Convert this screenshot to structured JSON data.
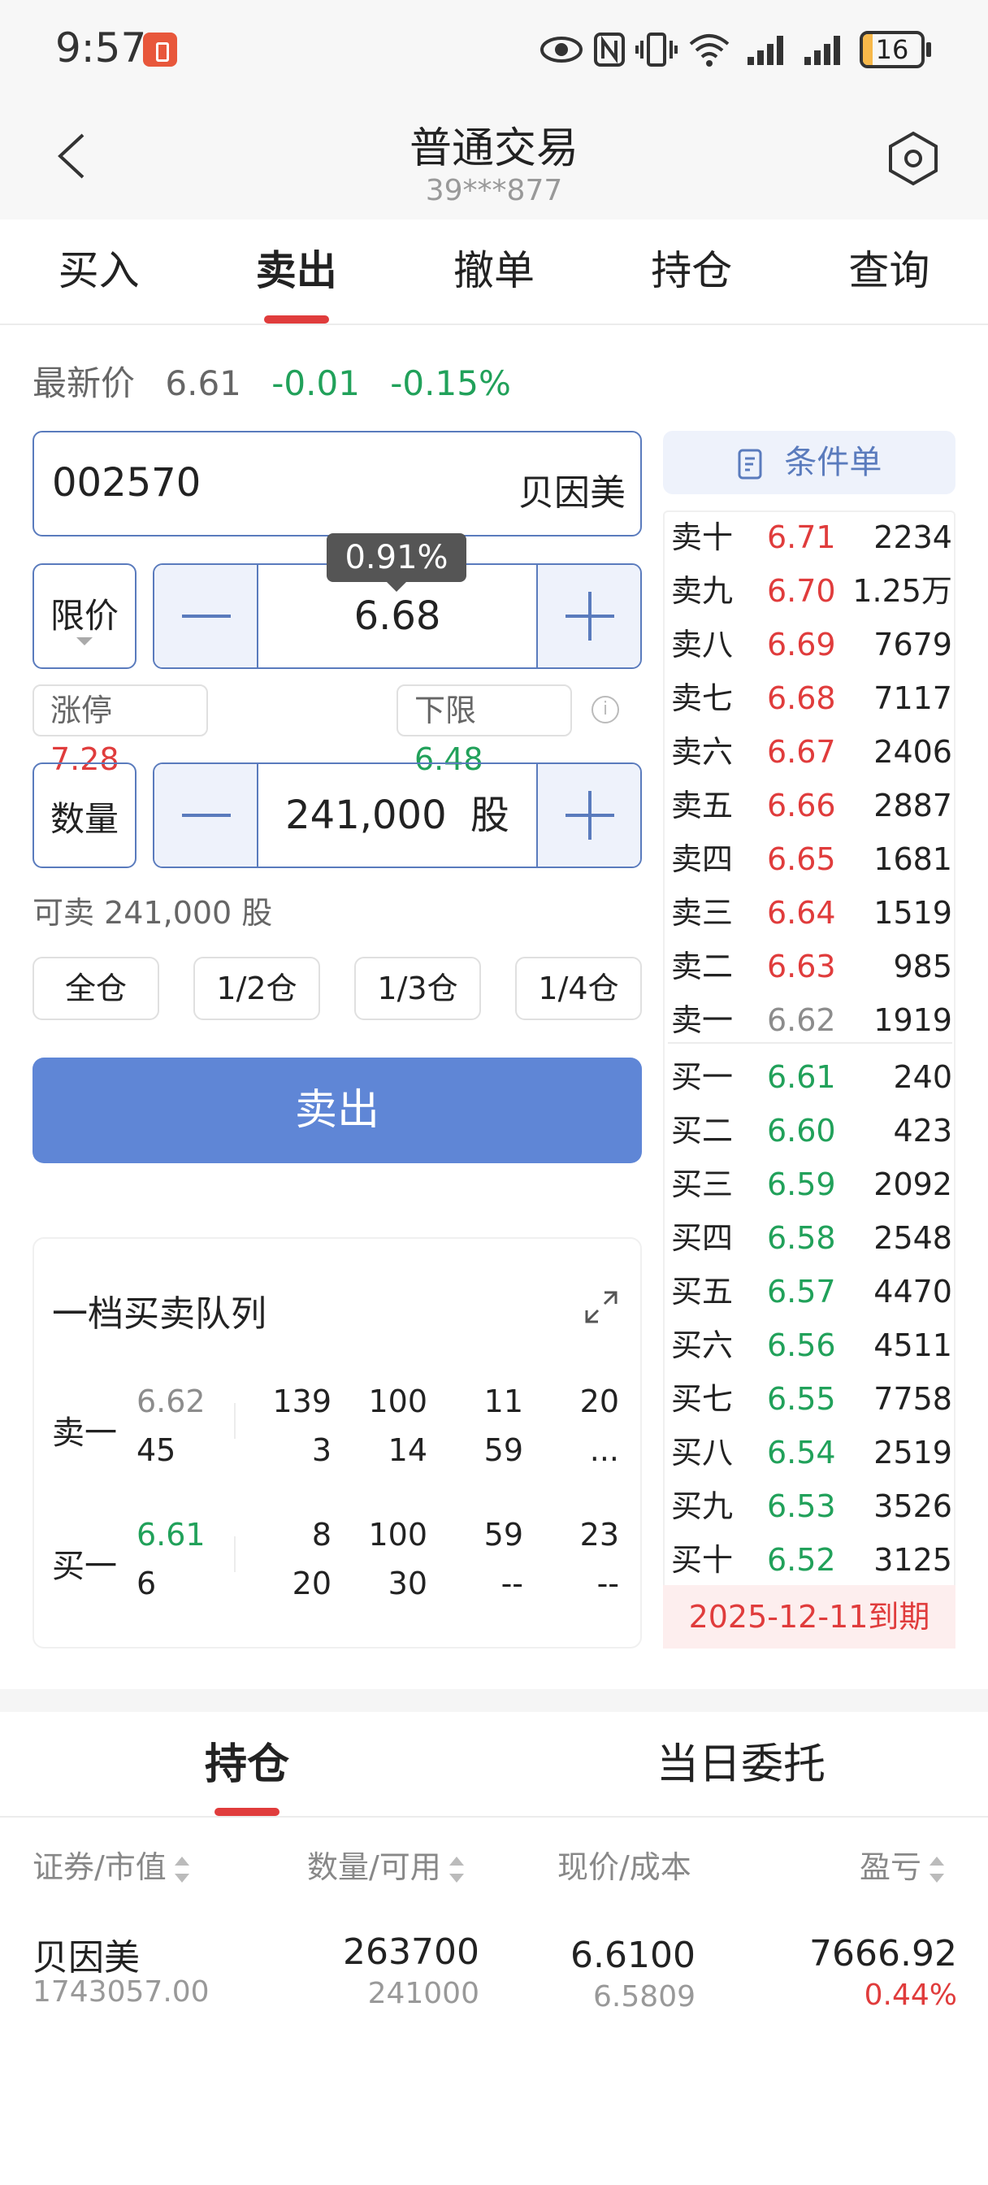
{
  "status_bar": {
    "time": "9:57",
    "battery": "16",
    "battery_level": 0.16,
    "icons": [
      "eye-icon",
      "nfc-icon",
      "vibrate-icon",
      "wifi-icon",
      "signal-icon",
      "signal-icon",
      "battery-icon"
    ]
  },
  "header": {
    "title": "普通交易",
    "account": "39***877"
  },
  "tabs": [
    "买入",
    "卖出",
    "撤单",
    "持仓",
    "查询"
  ],
  "active_tab": "卖出",
  "latest": {
    "label": "最新价",
    "price": "6.61",
    "change": "-0.01",
    "change_pct": "-0.15%"
  },
  "form": {
    "code": "002570",
    "name": "贝因美",
    "price_type": "限价",
    "price": "6.68",
    "price_tip": "0.91%",
    "limit_up_label": "涨停",
    "limit_up": "7.28",
    "limit_down_label": "下限",
    "limit_down": "6.48",
    "qty_label": "数量",
    "qty": "241,000",
    "qty_unit": "股",
    "sellable": "可卖 241,000 股",
    "fractions": [
      "全仓",
      "1/2仓",
      "1/3仓",
      "1/4仓"
    ],
    "submit": "卖出"
  },
  "queue": {
    "title": "一档买卖队列",
    "sell": {
      "side": "卖一",
      "price": "6.62",
      "count": "45",
      "row1": [
        "139",
        "100",
        "11",
        "20"
      ],
      "row2": [
        "3",
        "14",
        "59",
        "..."
      ]
    },
    "buy": {
      "side": "买一",
      "price": "6.61",
      "count": "6",
      "row1": [
        "8",
        "100",
        "59",
        "23"
      ],
      "row2": [
        "20",
        "30",
        "--",
        "--"
      ]
    }
  },
  "orderbook": {
    "condition_button": "条件单",
    "asks": [
      {
        "label": "卖十",
        "price": "6.71",
        "vol": "2234"
      },
      {
        "label": "卖九",
        "price": "6.70",
        "vol": "1.25万"
      },
      {
        "label": "卖八",
        "price": "6.69",
        "vol": "7679"
      },
      {
        "label": "卖七",
        "price": "6.68",
        "vol": "7117"
      },
      {
        "label": "卖六",
        "price": "6.67",
        "vol": "2406"
      },
      {
        "label": "卖五",
        "price": "6.66",
        "vol": "2887"
      },
      {
        "label": "卖四",
        "price": "6.65",
        "vol": "1681"
      },
      {
        "label": "卖三",
        "price": "6.64",
        "vol": "1519"
      },
      {
        "label": "卖二",
        "price": "6.63",
        "vol": "985"
      },
      {
        "label": "卖一",
        "price": "6.62",
        "vol": "1919"
      }
    ],
    "bids": [
      {
        "label": "买一",
        "price": "6.61",
        "vol": "240"
      },
      {
        "label": "买二",
        "price": "6.60",
        "vol": "423"
      },
      {
        "label": "买三",
        "price": "6.59",
        "vol": "2092"
      },
      {
        "label": "买四",
        "price": "6.58",
        "vol": "2548"
      },
      {
        "label": "买五",
        "price": "6.57",
        "vol": "4470"
      },
      {
        "label": "买六",
        "price": "6.56",
        "vol": "4511"
      },
      {
        "label": "买七",
        "price": "6.55",
        "vol": "7758"
      },
      {
        "label": "买八",
        "price": "6.54",
        "vol": "2519"
      },
      {
        "label": "买九",
        "price": "6.53",
        "vol": "3526"
      },
      {
        "label": "买十",
        "price": "6.52",
        "vol": "3125"
      }
    ],
    "expiry": "2025-12-11到期"
  },
  "bottom_tabs": [
    "持仓",
    "当日委托"
  ],
  "positions": {
    "headers": [
      "证券/市值",
      "数量/可用",
      "现价/成本",
      "盈亏"
    ],
    "rows": [
      {
        "name": "贝因美",
        "market_value": "1743057.00",
        "qty": "263700",
        "available": "241000",
        "price": "6.6100",
        "cost": "6.5809",
        "pnl": "7666.92",
        "pnl_pct": "0.44%"
      }
    ]
  },
  "colors": {
    "up": "#e03c3c",
    "down": "#21a15a",
    "accent": "#5f86d6",
    "neutral": "#8c8c8c"
  }
}
